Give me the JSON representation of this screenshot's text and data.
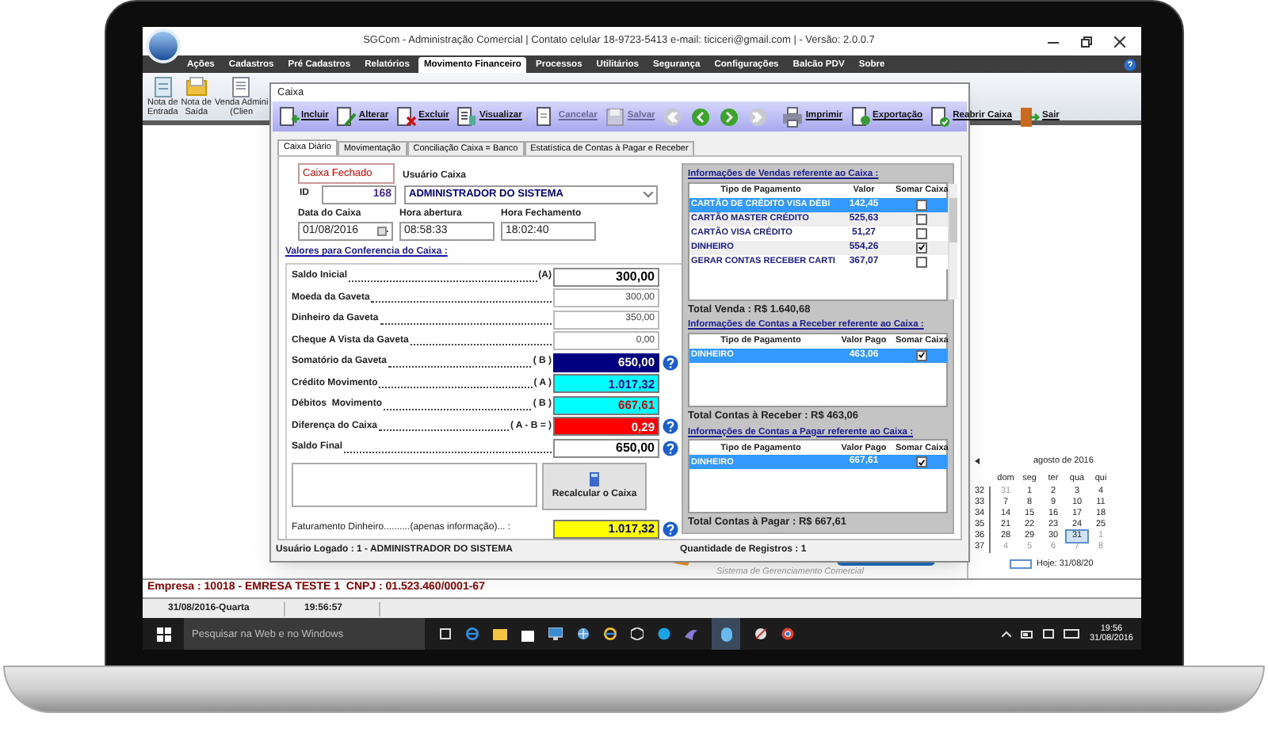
{
  "window": {
    "title": "SGCom - Administração Comercial | Contato celular 18-9723-5413 e-mail: ticiceri@gmail.com | - Versão: 2.0.0.7"
  },
  "menu": [
    {
      "label": "Ações",
      "selected": false
    },
    {
      "label": "Cadastros",
      "selected": false
    },
    {
      "label": "Pré Cadastros",
      "selected": false
    },
    {
      "label": "Relatórios",
      "selected": false
    },
    {
      "label": "Movimento Financeiro",
      "selected": true
    },
    {
      "label": "Processos",
      "selected": false
    },
    {
      "label": "Utilitários",
      "selected": false
    },
    {
      "label": "Segurança",
      "selected": false
    },
    {
      "label": "Configurações",
      "selected": false
    },
    {
      "label": "Balcão PDV",
      "selected": false
    },
    {
      "label": "Sobre",
      "selected": false
    }
  ],
  "ribbon": [
    {
      "kind": "entry",
      "lines": [
        "Nota de",
        "Entrada"
      ]
    },
    {
      "kind": "exit",
      "lines": [
        "Nota de",
        "Saída"
      ]
    },
    {
      "kind": "sale",
      "lines": [
        "Venda Admini",
        "(Clien"
      ]
    }
  ],
  "dialog": {
    "title": "Caixa",
    "toolbar": [
      {
        "kind": "add",
        "label": "Incluir",
        "disabled": false
      },
      {
        "kind": "edit",
        "label": "Alterar",
        "disabled": false
      },
      {
        "kind": "delete",
        "label": "Excluir",
        "disabled": false
      },
      {
        "kind": "view",
        "label": "Visualizar",
        "disabled": false
      },
      {
        "kind": "sep"
      },
      {
        "kind": "cancel",
        "label": "Cancelar",
        "disabled": true
      },
      {
        "kind": "save",
        "label": "Salvar",
        "disabled": true
      },
      {
        "kind": "first",
        "disabled": true
      },
      {
        "kind": "prev",
        "disabled": false
      },
      {
        "kind": "next",
        "disabled": false
      },
      {
        "kind": "last",
        "disabled": true
      },
      {
        "kind": "sep"
      },
      {
        "kind": "print",
        "label": "Imprimir",
        "disabled": false
      },
      {
        "kind": "export",
        "label": "Exportação",
        "disabled": false
      },
      {
        "kind": "reopen",
        "label": "Reabrir Caixa",
        "disabled": false
      },
      {
        "kind": "exit",
        "label": "Sair",
        "disabled": false
      }
    ],
    "tabs": [
      {
        "label": "Caixa Diário",
        "selected": true
      },
      {
        "label": "Movimentação",
        "selected": false
      },
      {
        "label": "Conciliação Caixa = Banco",
        "selected": false
      },
      {
        "label": "Estatística de Contas à Pagar e Receber",
        "selected": false
      }
    ],
    "form": {
      "status": "Caixa Fechado",
      "id_label": "ID",
      "id": "168",
      "user_label": "Usuário Caixa",
      "user": "ADMINISTRADOR DO SISTEMA",
      "date_label": "Data do Caixa",
      "date": "01/08/2016",
      "open_label": "Hora abertura",
      "open": "08:58:33",
      "close_label": "Hora Fechamento",
      "close": "18:02:40",
      "section": "Valores para Conferencia do Caixa :",
      "rows": [
        {
          "label": "Saldo Inicial",
          "tag": "(A)",
          "value": "300,00",
          "kind": "bold",
          "help": false
        },
        {
          "label": "Moeda da Gaveta",
          "value": "300,00",
          "kind": "plain",
          "help": false
        },
        {
          "label": "Dinheiro da Gaveta",
          "value": "350,00",
          "kind": "plain",
          "help": false
        },
        {
          "label": "Cheque A Vista da Gaveta",
          "value": "0,00",
          "kind": "plain",
          "help": false
        },
        {
          "label": "Somatório da Gaveta",
          "tag": "( B )",
          "value": "650,00",
          "kind": "sum",
          "help": true
        },
        {
          "label": "Crédito Movimento",
          "tag": "( A )",
          "value": "1.017,32",
          "kind": "credit",
          "help": false
        },
        {
          "label": "Débitos  Movimento",
          "tag": "( B )",
          "value": "667,61",
          "kind": "debit",
          "help": false
        },
        {
          "label": "Diferença do Caixa",
          "tag": "( A - B = )",
          "value": "0,29",
          "kind": "diff",
          "help": true
        },
        {
          "label": "Saldo Final",
          "value": "650,00",
          "kind": "bold",
          "help": true
        }
      ],
      "recalc": "Recalcular o Caixa",
      "revenue": {
        "label": "Faturamento Dinheiro..........(apenas informação)... :",
        "value": "1.017,32",
        "help": true
      }
    },
    "sections": [
      {
        "title": "Informações de Vendas referente ao Caixa :",
        "columns": [
          "Tipo de Pagamento",
          "Valor",
          "Somar Caixa"
        ],
        "scroll": true,
        "rows": [
          {
            "type": "CARTÃO DE CRÉDITO VISA DÉBI",
            "value": "142,45",
            "checked": false,
            "selected": true
          },
          {
            "type": "CARTÃO MASTER CRÉDITO",
            "value": "525,63",
            "checked": false,
            "selected": false
          },
          {
            "type": "CARTÃO VISA CRÉDITO",
            "value": "51,27",
            "checked": false,
            "selected": false
          },
          {
            "type": "DINHEIRO",
            "value": "554,26",
            "checked": true,
            "selected": false
          },
          {
            "type": "GERAR CONTAS RECEBER CARTI",
            "value": "367,07",
            "checked": false,
            "selected": false
          }
        ],
        "total": "Total Venda : R$ 1.640,68"
      },
      {
        "title": "Informações de Contas a Receber referente ao Caixa :",
        "columns": [
          "Tipo de Pagamento",
          "Valor Pago",
          "Somar Caixa"
        ],
        "scroll": false,
        "rows": [
          {
            "type": "DINHEIRO",
            "value": "463,06",
            "checked": true,
            "selected": true
          }
        ],
        "total": "Total Contas à Receber : R$ 463,06"
      },
      {
        "title": "Informações de Contas a Pagar referente ao Caixa :",
        "columns": [
          "Tipo de Pagamento",
          "Valor Pago",
          "Somar Caixa"
        ],
        "scroll": false,
        "rows": [
          {
            "type": "DINHEIRO",
            "value": "667,61",
            "checked": true,
            "selected": true
          }
        ],
        "total": "Total Contas à Pagar : R$ 667,61"
      }
    ],
    "status": [
      "Usuário Logado : 1 - ADMINISTRADOR DO SISTEMA",
      "Quantidade de Registros : 1"
    ]
  },
  "tagline": "Sistema de Gerenciamento Comercial",
  "calendar": {
    "month": "agosto de 2016",
    "weekdays": [
      "dom",
      "seg",
      "ter",
      "qua",
      "qui"
    ],
    "weeks": [
      {
        "number": "32",
        "days": [
          {
            "d": "31",
            "muted": true,
            "selected": false
          },
          {
            "d": "1",
            "muted": false,
            "selected": false
          },
          {
            "d": "2",
            "muted": false,
            "selected": false
          },
          {
            "d": "3",
            "muted": false,
            "selected": false
          },
          {
            "d": "4",
            "muted": false,
            "selected": false
          }
        ]
      },
      {
        "number": "33",
        "days": [
          {
            "d": "7",
            "muted": false,
            "selected": false
          },
          {
            "d": "8",
            "muted": false,
            "selected": false
          },
          {
            "d": "9",
            "muted": false,
            "selected": false
          },
          {
            "d": "10",
            "muted": false,
            "selected": false
          },
          {
            "d": "11",
            "muted": false,
            "selected": false
          }
        ]
      },
      {
        "number": "34",
        "days": [
          {
            "d": "14",
            "muted": false,
            "selected": false
          },
          {
            "d": "15",
            "muted": false,
            "selected": false
          },
          {
            "d": "16",
            "muted": false,
            "selected": false
          },
          {
            "d": "17",
            "muted": false,
            "selected": false
          },
          {
            "d": "18",
            "muted": false,
            "selected": false
          }
        ]
      },
      {
        "number": "35",
        "days": [
          {
            "d": "21",
            "muted": false,
            "selected": false
          },
          {
            "d": "22",
            "muted": false,
            "selected": false
          },
          {
            "d": "23",
            "muted": false,
            "selected": false
          },
          {
            "d": "24",
            "muted": false,
            "selected": false
          },
          {
            "d": "25",
            "muted": false,
            "selected": false
          }
        ]
      },
      {
        "number": "36",
        "days": [
          {
            "d": "28",
            "muted": false,
            "selected": false
          },
          {
            "d": "29",
            "muted": false,
            "selected": false
          },
          {
            "d": "30",
            "muted": false,
            "selected": false
          },
          {
            "d": "31",
            "muted": false,
            "selected": true
          },
          {
            "d": "1",
            "muted": true,
            "selected": false
          }
        ]
      },
      {
        "number": "37",
        "days": [
          {
            "d": "4",
            "muted": true,
            "selected": false
          },
          {
            "d": "5",
            "muted": true,
            "selected": false
          },
          {
            "d": "6",
            "muted": true,
            "selected": false
          },
          {
            "d": "7",
            "muted": true,
            "selected": false
          },
          {
            "d": "8",
            "muted": true,
            "selected": false
          }
        ]
      }
    ],
    "today": "Hoje: 31/08/20"
  },
  "company": "Empresa : 10018 - EMRESA TESTE 1  CNPJ : 01.523.460/0001-67",
  "status_bar": [
    "31/08/2016-Quarta",
    "19:56:57"
  ],
  "taskbar": {
    "placeholder": "Pesquisar na Web e no Windows",
    "time": "19:56",
    "date": "31/08/2016"
  }
}
